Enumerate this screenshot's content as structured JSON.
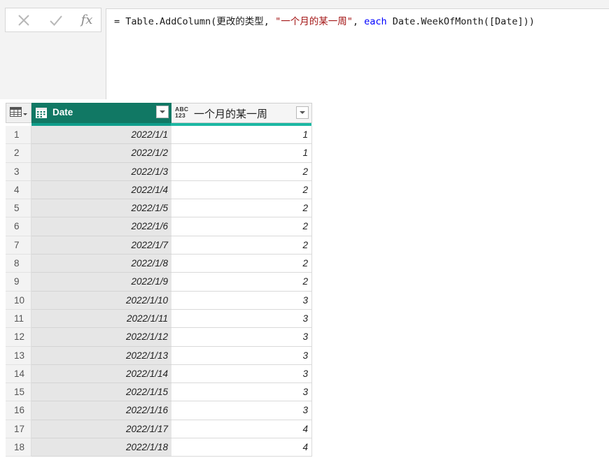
{
  "formula_bar": {
    "cancel_icon": "x-icon",
    "confirm_icon": "check-icon",
    "fx_label": "fx",
    "formula": {
      "prefix": "= Table.AddColumn(更改的类型, ",
      "string_literal": "\"一个月的某一周\"",
      "separator": ", ",
      "keyword": "each",
      "suffix": " Date.WeekOfMonth([Date]))"
    }
  },
  "table": {
    "corner_icon": "table-menu-icon",
    "columns": [
      {
        "name": "Date",
        "type_icon": "calendar-icon"
      },
      {
        "name": "一个月的某一周",
        "type_icon": "abc-123-icon",
        "type_label_top": "ABC",
        "type_label_bottom": "123"
      }
    ],
    "rows": [
      {
        "index": "1",
        "date": "2022/1/1",
        "week": "1"
      },
      {
        "index": "2",
        "date": "2022/1/2",
        "week": "1"
      },
      {
        "index": "3",
        "date": "2022/1/3",
        "week": "2"
      },
      {
        "index": "4",
        "date": "2022/1/4",
        "week": "2"
      },
      {
        "index": "5",
        "date": "2022/1/5",
        "week": "2"
      },
      {
        "index": "6",
        "date": "2022/1/6",
        "week": "2"
      },
      {
        "index": "7",
        "date": "2022/1/7",
        "week": "2"
      },
      {
        "index": "8",
        "date": "2022/1/8",
        "week": "2"
      },
      {
        "index": "9",
        "date": "2022/1/9",
        "week": "2"
      },
      {
        "index": "10",
        "date": "2022/1/10",
        "week": "3"
      },
      {
        "index": "11",
        "date": "2022/1/11",
        "week": "3"
      },
      {
        "index": "12",
        "date": "2022/1/12",
        "week": "3"
      },
      {
        "index": "13",
        "date": "2022/1/13",
        "week": "3"
      },
      {
        "index": "14",
        "date": "2022/1/14",
        "week": "3"
      },
      {
        "index": "15",
        "date": "2022/1/15",
        "week": "3"
      },
      {
        "index": "16",
        "date": "2022/1/16",
        "week": "3"
      },
      {
        "index": "17",
        "date": "2022/1/17",
        "week": "4"
      },
      {
        "index": "18",
        "date": "2022/1/18",
        "week": "4"
      }
    ]
  },
  "colors": {
    "date_header_bg": "#117864",
    "teal_strip": "#1bb7a3",
    "string_literal": "#a31515",
    "keyword": "#0000ff"
  }
}
